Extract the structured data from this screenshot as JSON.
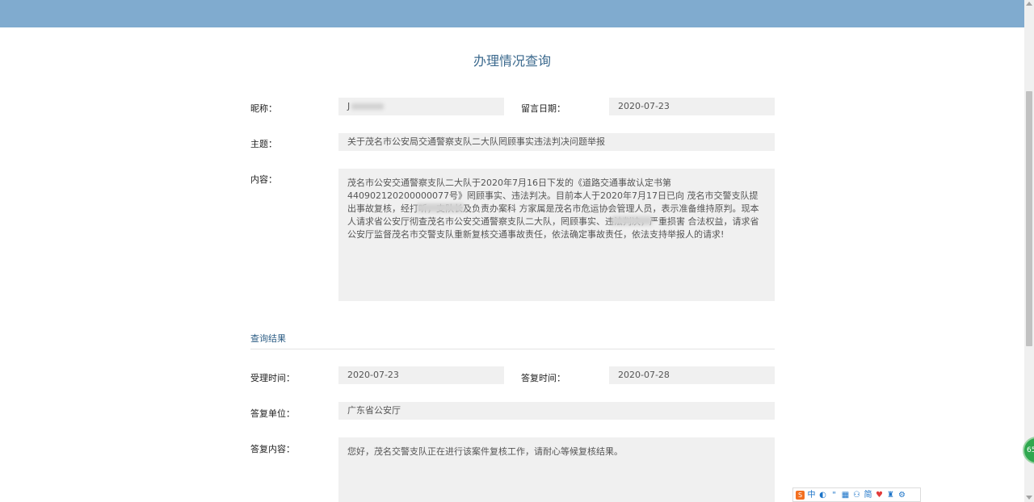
{
  "page": {
    "title": "办理情况查询"
  },
  "form": {
    "nickname_label": "昵称：",
    "nickname_value": "J",
    "date_label": "留言日期：",
    "date_value": "2020-07-23",
    "subject_label": "主题：",
    "subject_value": "关于茂名市公安局交通警察支队二大队罔顾事实违法判决问题举报",
    "content_label": "内容：",
    "content_value": "茂名市公安交通警察支队二大队于2020年7月16日下发的《道路交通事故认定书第440902120200000077号》罔顾事实、违法判决。目前本人于2020年7月17日已向 茂名市交警支队提出事故复核，经打听，支队长及负责办案科          方家属是茂名市危运协会管理人员，表示准备维持原判。现本人请求省公安厅彻查茂名市公安交通警察支队二大队，罔顾事实、违法判决，严重损害          合法权益，请求省公安厅监督茂名市交警支队重新复核交通事故责任，依法确定事故责任，依法支持举报人的请求!"
  },
  "result": {
    "section_title": "查询结果",
    "accept_time_label": "受理时间：",
    "accept_time_value": "2020-07-23",
    "reply_time_label": "答复时间：",
    "reply_time_value": "2020-07-28",
    "reply_unit_label": "答复单位：",
    "reply_unit_value": "广东省公安厅",
    "reply_content_label": "答复内容：",
    "reply_content_value": "您好，茂名交警支队正在进行该案件复核工作，请耐心等候复核结果。"
  },
  "overlay": {
    "badge_text": "65",
    "ime_items": [
      "中",
      "◐",
      "\"",
      "▦",
      "⚇",
      "简",
      "♥",
      "♜",
      "⚙"
    ]
  },
  "colors": {
    "topbar": "#80abcf",
    "title": "#3c6a8e",
    "field_bg": "#f0f0f0"
  }
}
